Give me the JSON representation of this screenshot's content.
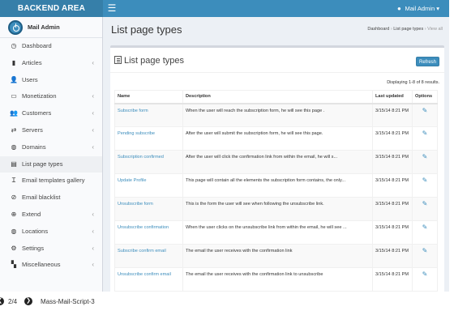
{
  "header": {
    "logo": "BACKEND AREA",
    "menu_icon": "hamburger-icon",
    "user_label": "Mail Admin",
    "user_icon": "user-icon",
    "caret": "▾"
  },
  "sidebar": {
    "user_name": "Mail Admin",
    "items": [
      {
        "label": "Dashboard",
        "icon": "clock-icon",
        "glyph": "◷",
        "has_children": false
      },
      {
        "label": "Articles",
        "icon": "book-icon",
        "glyph": "▮",
        "has_children": true
      },
      {
        "label": "Users",
        "icon": "user-icon",
        "glyph": "👤",
        "has_children": false
      },
      {
        "label": "Monetization",
        "icon": "money-icon",
        "glyph": "▭",
        "has_children": true
      },
      {
        "label": "Customers",
        "icon": "users-icon",
        "glyph": "👥",
        "has_children": true
      },
      {
        "label": "Servers",
        "icon": "exchange-icon",
        "glyph": "⇄",
        "has_children": true
      },
      {
        "label": "Domains",
        "icon": "globe-icon",
        "glyph": "◍",
        "has_children": true
      },
      {
        "label": "List page types",
        "icon": "list-icon",
        "glyph": "▤",
        "has_children": false,
        "active": true
      },
      {
        "label": "Email templates gallery",
        "icon": "text-cursor-icon",
        "glyph": "Ɪ",
        "has_children": false
      },
      {
        "label": "Email blacklist",
        "icon": "ban-icon",
        "glyph": "⊘",
        "has_children": false
      },
      {
        "label": "Extend",
        "icon": "plus-circle-icon",
        "glyph": "⊕",
        "has_children": true
      },
      {
        "label": "Locations",
        "icon": "globe-icon",
        "glyph": "◍",
        "has_children": true
      },
      {
        "label": "Settings",
        "icon": "gear-icon",
        "glyph": "⚙",
        "has_children": true
      },
      {
        "label": "Miscellaneous",
        "icon": "bookmark-icon",
        "glyph": "▚",
        "has_children": true
      }
    ],
    "chevron": "‹"
  },
  "content": {
    "title": "List page types",
    "breadcrumb": [
      "Dashboard",
      "List page types",
      "View all"
    ],
    "breadcrumb_sep": "›"
  },
  "box": {
    "title": "List page types",
    "refresh_label": "Refresh",
    "displaying": "Displaying 1-8 of 8 results.",
    "columns": [
      "Name",
      "Description",
      "Last updated",
      "Options"
    ],
    "edit_glyph": "✎",
    "rows": [
      {
        "name": "Subscribe form",
        "description": "When the user will reach the subscription form, he will see this page .",
        "updated": "3/15/14 8:21 PM"
      },
      {
        "name": "Pending subscribe",
        "description": "After the user will submit the subscription form, he will see this page.",
        "updated": "3/15/14 8:21 PM"
      },
      {
        "name": "Subscription confirmed",
        "description": "After the user will click the confirmation link from within the email, he will s...",
        "updated": "3/15/14 8:21 PM"
      },
      {
        "name": "Update Profile",
        "description": "This page will contain all the elements the subscription form contains, the only...",
        "updated": "3/15/14 8:21 PM"
      },
      {
        "name": "Unsubscribe form",
        "description": "This is the form the user will see when following the unsubscribe link.",
        "updated": "3/15/14 8:21 PM"
      },
      {
        "name": "Unsubscribe confirmation",
        "description": "When the user clicks on the unsubscribe link from within the email, he will see ...",
        "updated": "3/15/14 8:21 PM"
      },
      {
        "name": "Subscribe confirm email",
        "description": "The email the user receives with the confirmation link",
        "updated": "3/15/14 8:21 PM"
      },
      {
        "name": "Unsubscribe confirm email",
        "description": "The email the user receives with the confirmation link to unsubscribe",
        "updated": "3/15/14 8:21 PM"
      }
    ]
  },
  "caption": {
    "counter": "2/4",
    "title": "Mass-Mail-Script-3"
  },
  "colors": {
    "accent": "#3c8dbc",
    "logo_bg": "#367fa9"
  }
}
